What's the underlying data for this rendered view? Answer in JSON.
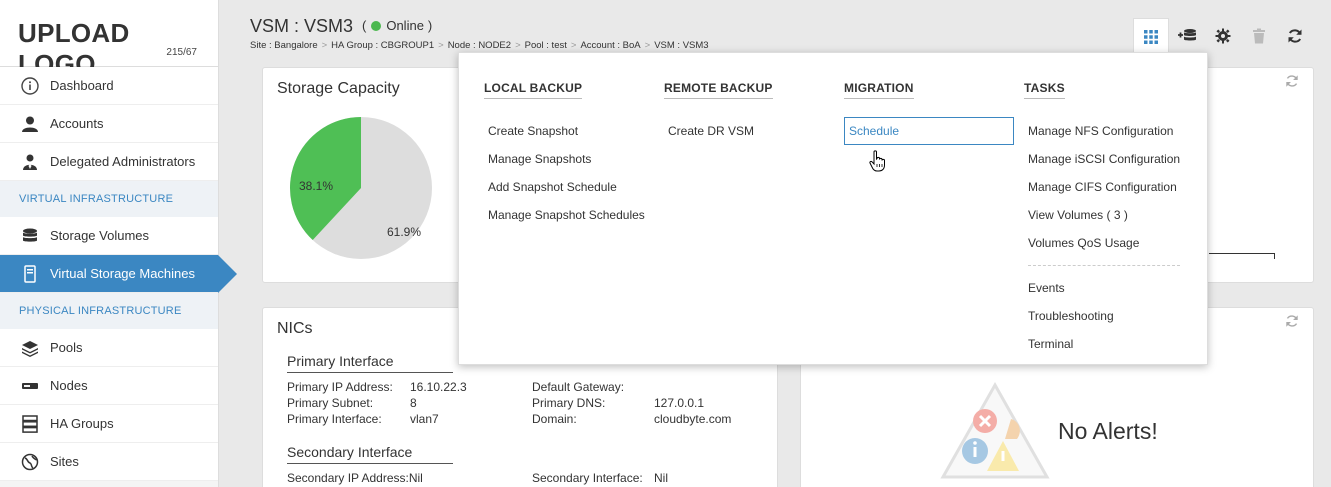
{
  "logo": {
    "text": "UPLOAD LOGO",
    "dims": "215/67"
  },
  "sidebar": {
    "items": [
      {
        "label": "Dashboard",
        "icon": "info-icon"
      },
      {
        "label": "Accounts",
        "icon": "user-icon"
      },
      {
        "label": "Delegated Administrators",
        "icon": "admin-icon"
      }
    ],
    "section_virtual": "VIRTUAL INFRASTRUCTURE",
    "virtual_items": [
      {
        "label": "Storage Volumes",
        "icon": "database-icon"
      },
      {
        "label": "Virtual Storage Machines",
        "icon": "vsm-icon"
      }
    ],
    "section_physical": "PHYSICAL INFRASTRUCTURE",
    "physical_items": [
      {
        "label": "Pools",
        "icon": "layers-icon"
      },
      {
        "label": "Nodes",
        "icon": "node-icon"
      },
      {
        "label": "HA Groups",
        "icon": "server-stack-icon"
      },
      {
        "label": "Sites",
        "icon": "globe-icon"
      }
    ]
  },
  "header": {
    "title": "VSM : VSM3",
    "status": "Online",
    "breadcrumb": [
      "Site : Bangalore",
      "HA Group : CBGROUP1",
      "Node : NODE2",
      "Pool : test",
      "Account : BoA",
      "VSM : VSM3"
    ]
  },
  "storage": {
    "title": "Storage Capacity",
    "used_label": "38.1%",
    "free_label": "61.9%",
    "used_fraction": 0.381,
    "used_color": "#4fbf55",
    "free_color": "#dddddd"
  },
  "nics": {
    "title": "NICs",
    "primary_head": "Primary Interface",
    "primary": [
      {
        "k": "Primary IP Address:",
        "v": "16.10.22.3"
      },
      {
        "k": "Primary Subnet:",
        "v": "8"
      },
      {
        "k": "Primary Interface:",
        "v": "vlan7"
      }
    ],
    "primary_right": [
      {
        "k": "Default Gateway:",
        "v": ""
      },
      {
        "k": "Primary DNS:",
        "v": "127.0.0.1"
      },
      {
        "k": "Domain:",
        "v": "cloudbyte.com"
      }
    ],
    "secondary_head": "Secondary Interface",
    "secondary_ip": "Secondary IP Address:Nil",
    "secondary_iface_k": "Secondary Interface:",
    "secondary_iface_v": "Nil"
  },
  "alerts": {
    "text": "No Alerts!"
  },
  "menu": {
    "local_backup": {
      "head": "LOCAL BACKUP",
      "items": [
        "Create Snapshot",
        "Manage Snapshots",
        "Add Snapshot Schedule",
        "Manage Snapshot Schedules"
      ]
    },
    "remote_backup": {
      "head": "REMOTE BACKUP",
      "items": [
        "Create DR VSM"
      ]
    },
    "migration": {
      "head": "MIGRATION",
      "items": [
        "Schedule"
      ]
    },
    "tasks": {
      "head": "TASKS",
      "items": [
        "Manage NFS Configuration",
        "Manage iSCSI Configuration",
        "Manage CIFS Configuration",
        "View Volumes ( 3 )",
        "Volumes QoS Usage"
      ],
      "items2": [
        "Events",
        "Troubleshooting",
        "Terminal"
      ]
    }
  }
}
